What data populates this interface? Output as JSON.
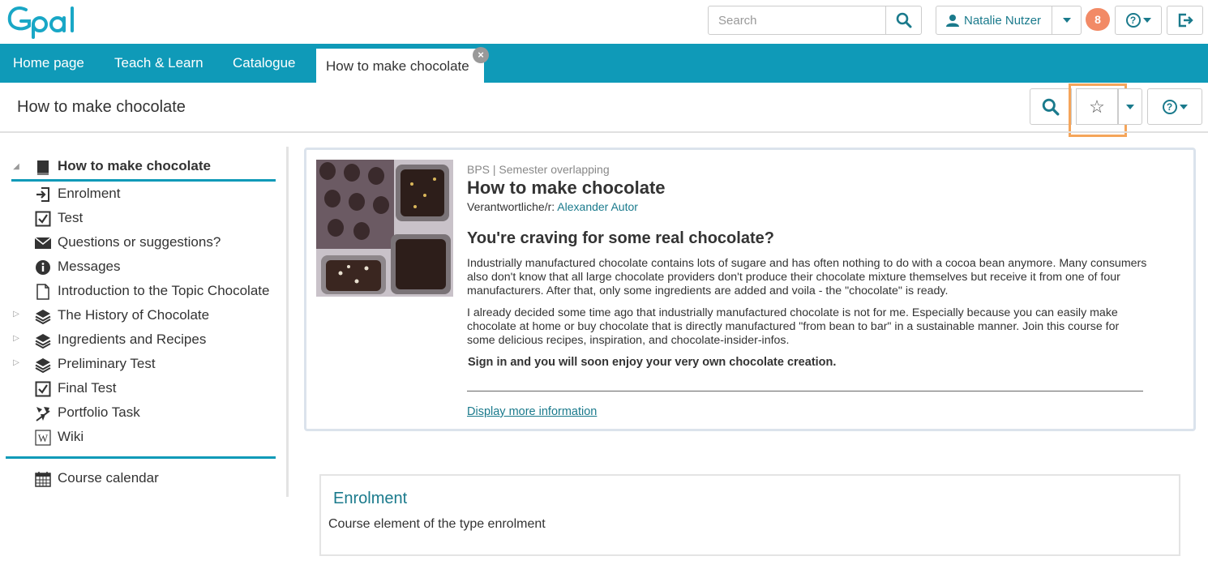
{
  "header": {
    "logo_text": "Opal",
    "search_placeholder": "Search",
    "user_name": "Natalie Nutzer",
    "notification_count": "8",
    "help_label": "?"
  },
  "nav": {
    "tabs": [
      {
        "label": "Home page"
      },
      {
        "label": "Teach & Learn"
      },
      {
        "label": "Catalogue"
      }
    ],
    "active_tab": "How to make chocolate",
    "close_label": "×"
  },
  "course_header": {
    "title": "How to make chocolate",
    "help_label": "?",
    "favorite_icon": "☆"
  },
  "sidebar": {
    "root": {
      "label": "How to make chocolate",
      "icon": "book-icon"
    },
    "items": [
      {
        "label": "Enrolment",
        "icon": "enrolment-icon",
        "expandable": false
      },
      {
        "label": "Test",
        "icon": "checkbox-icon",
        "expandable": false
      },
      {
        "label": "Questions or suggestions?",
        "icon": "envelope-icon",
        "expandable": false
      },
      {
        "label": "Messages",
        "icon": "info-icon",
        "expandable": false
      },
      {
        "label": "Introduction to the Topic Chocolate",
        "icon": "document-icon",
        "expandable": false
      },
      {
        "label": "The History of Chocolate",
        "icon": "layers-icon",
        "expandable": true
      },
      {
        "label": "Ingredients and Recipes",
        "icon": "layers-icon",
        "expandable": true
      },
      {
        "label": "Preliminary Test",
        "icon": "layers-icon",
        "expandable": true
      },
      {
        "label": "Final Test",
        "icon": "checkbox-icon",
        "expandable": false
      },
      {
        "label": "Portfolio Task",
        "icon": "portfolio-icon",
        "expandable": false
      },
      {
        "label": "Wiki",
        "icon": "wiki-icon",
        "expandable": false
      }
    ],
    "calendar": {
      "label": "Course calendar",
      "icon": "calendar-icon"
    }
  },
  "course_info": {
    "meta": "BPS | Semester overlapping",
    "title": "How to make chocolate",
    "responsible_label": "Verantwortliche/r:",
    "responsible_name": "Alexander Autor",
    "subtitle": "You're craving for some real chocolate?",
    "paragraph1": "Industrially manufactured chocolate contains lots of sugare and has often nothing to do with a cocoa bean anymore. Many consumers also don't know that all large chocolate providers don't produce their chocolate mixture themselves but receive it from one of four manufacturers. After that, only some ingredients are added and voila - the \"chocolate\" is ready.",
    "paragraph2": "I already decided some time ago that industrially manufactured chocolate is not for me. Especially because you can easily make chocolate at home or buy chocolate that is directly manufactured \"from bean to bar\" in a sustainable manner. Join this course for some delicious recipes, inspiration, and chocolate-insider-infos.",
    "bold_line": "Sign in and you will soon enjoy your very own chocolate creation.",
    "more_link": "Display more information"
  },
  "enrolment": {
    "title": "Enrolment",
    "description": "Course element of the type enrolment"
  },
  "colors": {
    "brand": "#0f9ab8",
    "link": "#1a7a8c",
    "badge": "#f28a66",
    "highlight": "#f5a55a"
  }
}
